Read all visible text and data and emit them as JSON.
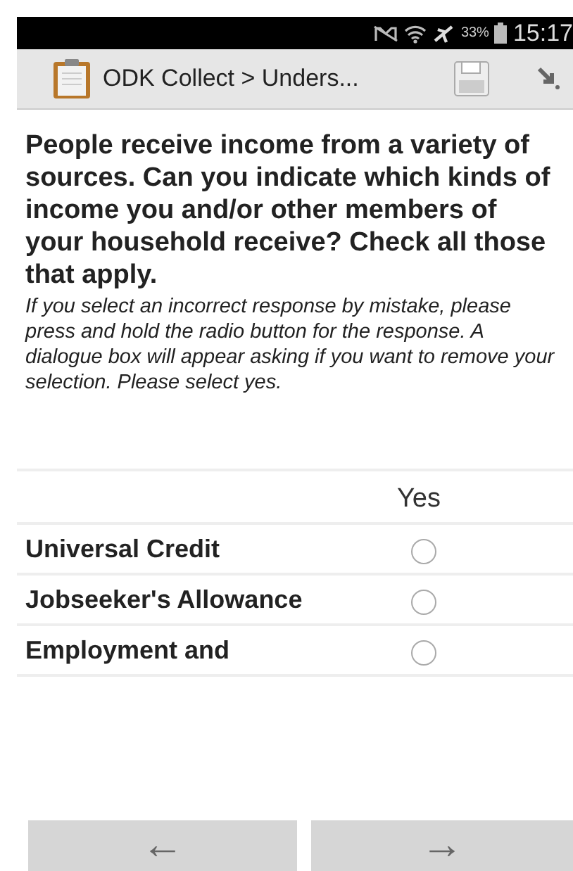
{
  "status_bar": {
    "battery": "33%",
    "time": "15:17"
  },
  "toolbar": {
    "title": "ODK Collect > Unders..."
  },
  "question": {
    "text": "People receive income from a variety of sources. Can you indicate which kinds of income you and/or other members of your household receive? Check all those that apply.",
    "hint": "If you select an incorrect response by mistake, please press and hold the radio button for the response. A dialogue box will appear asking if you want to remove your selection. Please select yes."
  },
  "table": {
    "columns": [
      "Yes"
    ],
    "rows": [
      {
        "label": "Universal Credit",
        "selected": false
      },
      {
        "label": "Jobseeker's Allowance",
        "selected": false
      },
      {
        "label": "Employment and",
        "selected": false
      }
    ]
  },
  "nav": {
    "back": "←",
    "next": "→"
  }
}
